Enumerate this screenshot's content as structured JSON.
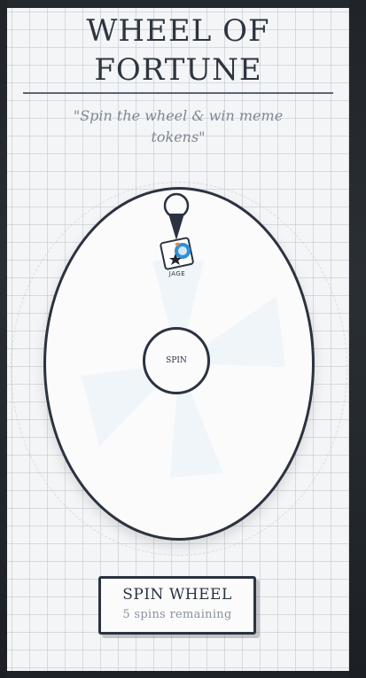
{
  "header": {
    "title_line1": "WHEEL OF",
    "title_line2": "FORTUNE",
    "subtitle": "\"Spin the wheel & win meme tokens\""
  },
  "wheel": {
    "segments": [
      {
        "token": "JAGE",
        "icon": "jage-token-icon"
      }
    ],
    "hub_label": "SPIN",
    "pointer_icon": "pin-pointer-icon"
  },
  "spin_button": {
    "label": "SPIN WHEEL",
    "remaining": "5 spins remaining"
  },
  "colors": {
    "ink": "#2b3340",
    "muted": "#7d8796",
    "card": "#f4f5f6",
    "frame": "#1f2328"
  }
}
